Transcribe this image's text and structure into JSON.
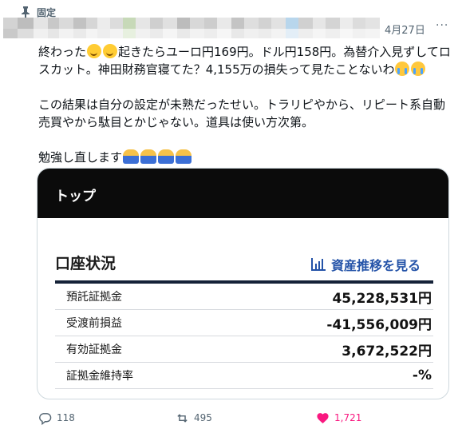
{
  "pinned_label": "固定",
  "date": "4月27日",
  "tweet": {
    "line1_a": "終わった",
    "line1_b": "起きたらユーロ円169円。ドル円158円。為替介入見ずしてロ",
    "line2_a": "スカット。神田財務官寝てた？4,155万の損失って見たことないわ",
    "line3": "この結果は自分の設定が未熟だったせい。トラリピやから、リピート系自動",
    "line4": "売買やから駄目とかじゃない。道具は使い方次第。",
    "line5": "勉強し直します"
  },
  "card": {
    "header": "トップ",
    "section_title": "口座状況",
    "asset_link": "資産推移を見る",
    "rows": [
      {
        "label": "預託証拠金",
        "value": "45,228,531円"
      },
      {
        "label": "受渡前損益",
        "value": "-41,556,009円"
      },
      {
        "label": "有効証拠金",
        "value": "3,672,522円"
      },
      {
        "label": "証拠金維持率",
        "value": "-%"
      }
    ]
  },
  "actions": {
    "replies": "118",
    "reposts": "495",
    "likes": "1,721"
  },
  "colors": {
    "accent_blue": "#2453a8",
    "like_pink": "#f91880",
    "muted": "#536471"
  }
}
